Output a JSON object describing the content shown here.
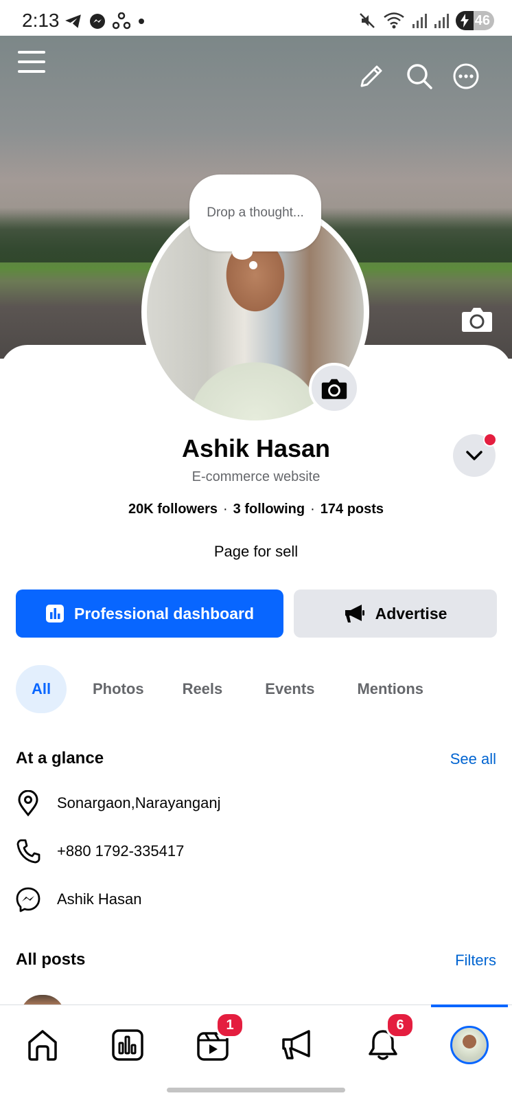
{
  "status_bar": {
    "time": "2:13",
    "left_icons": [
      "telegram-icon",
      "messenger-icon",
      "sync-icon",
      "dot-icon"
    ],
    "right_icons": [
      "mute-icon",
      "wifi-icon",
      "signal-icon",
      "signal-icon"
    ],
    "battery": "46"
  },
  "cover": {
    "icons": [
      "menu-icon",
      "edit-icon",
      "search-icon",
      "more-icon",
      "camera-icon"
    ]
  },
  "thought_bubble": {
    "placeholder": "Drop a thought..."
  },
  "profile": {
    "name": "Ashik Hasan",
    "category": "E-commerce website",
    "stats": {
      "followers": "20K followers",
      "following": "3 following",
      "posts": "174 posts",
      "separator": "·"
    },
    "bio": "Page for sell"
  },
  "actions": {
    "primary_label": "Professional dashboard",
    "secondary_label": "Advertise"
  },
  "tabs": [
    {
      "label": "All",
      "active": true
    },
    {
      "label": "Photos"
    },
    {
      "label": "Reels"
    },
    {
      "label": "Events"
    },
    {
      "label": "Mentions"
    }
  ],
  "at_a_glance": {
    "title": "At a glance",
    "link": "See all",
    "items": [
      {
        "icon": "location-pin-icon",
        "text": "Sonargaon,Narayanganj"
      },
      {
        "icon": "phone-icon",
        "text": "+880 1792-335417"
      },
      {
        "icon": "messenger-icon",
        "text": "Ashik Hasan"
      }
    ]
  },
  "all_posts": {
    "title": "All posts",
    "link": "Filters"
  },
  "bottom_nav": {
    "items": [
      {
        "icon": "home-icon"
      },
      {
        "icon": "dashboard-icon"
      },
      {
        "icon": "video-icon",
        "badge": "1"
      },
      {
        "icon": "megaphone-icon"
      },
      {
        "icon": "bell-icon",
        "badge": "6"
      },
      {
        "icon": "profile-avatar-icon",
        "active": true
      }
    ]
  },
  "colors": {
    "brand_blue": "#0866ff",
    "link_blue": "#0064d1",
    "badge_red": "#e41e3f",
    "secondary_gray": "#e4e6eb",
    "muted_text": "#65676b"
  }
}
